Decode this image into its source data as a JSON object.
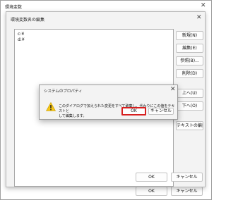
{
  "outer_window": {
    "title": "環境変数",
    "close_glyph": "✕",
    "ok_label": "OK",
    "cancel_label": "キャンセル"
  },
  "edit_window": {
    "title": "環境変数名の編集",
    "close_glyph": "✕",
    "list_items": [
      "c:¥",
      "d:¥"
    ],
    "buttons": {
      "new": "新規(N)",
      "edit": "編集(E)",
      "browse": "参照(B)...",
      "delete": "削除(D)",
      "move_up": "上へ(U)",
      "move_down": "下へ(O)",
      "edit_text": "テキストの編集(T)..."
    },
    "ok_label": "OK",
    "cancel_label": "キャンセル"
  },
  "dialog": {
    "title": "システムのプロパティ",
    "close_glyph": "✕",
    "message_line1": "このダイアログで加えられた変更をすべて破棄し、代わりにこの値をテキストと",
    "message_line2": "して編集します。",
    "ok_label": "OK",
    "cancel_label": "キャンセル",
    "icon": "warning-icon"
  },
  "colors": {
    "warning": "#f4c518",
    "focus_ring": "#d71f1f"
  }
}
